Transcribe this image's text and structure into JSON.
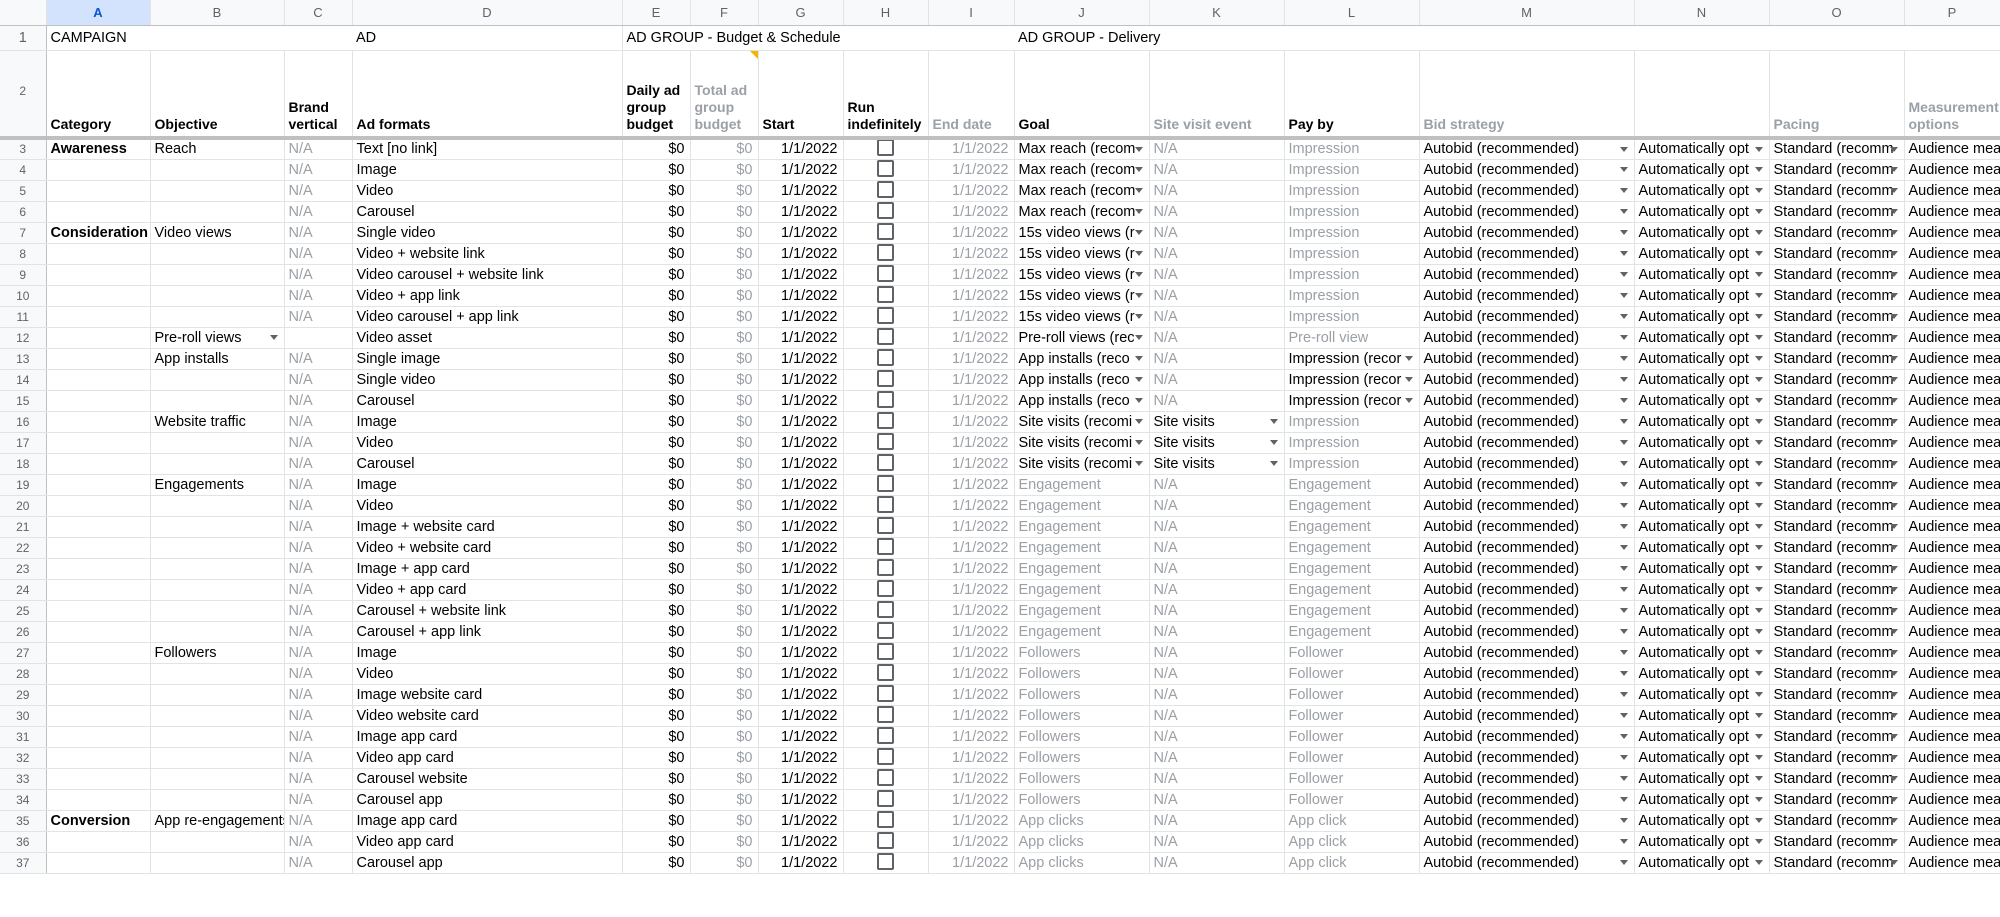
{
  "columns": [
    "A",
    "B",
    "C",
    "D",
    "E",
    "F",
    "G",
    "H",
    "I",
    "J",
    "K",
    "L",
    "M",
    "N",
    "O",
    "P"
  ],
  "row1": {
    "campaign": "CAMPAIGN",
    "ad": "AD",
    "budget_schedule": "AD GROUP - Budget & Schedule",
    "delivery": "AD GROUP - Delivery"
  },
  "headers": {
    "category": "Category",
    "objective": "Objective",
    "brand_vertical": "Brand vertical",
    "ad_formats": "Ad formats",
    "daily_budget": "Daily ad group budget",
    "total_budget": "Total ad group budget",
    "start": "Start",
    "run_indefinitely": "Run indefinitely",
    "end_date": "End date",
    "goal": "Goal",
    "site_visit_event": "Site visit event",
    "pay_by": "Pay by",
    "bid_strategy": "Bid strategy",
    "n_header": "",
    "pacing": "Pacing",
    "measurement": "Measurement options"
  },
  "defaults": {
    "brand_vertical": "N/A",
    "daily_budget": "$0",
    "total_budget": "$0",
    "start": "1/1/2022",
    "end_date": "1/1/2022",
    "bid_strategy": "Autobid (recommended)",
    "n_value": "Automatically opt",
    "pacing": "Standard (recomm",
    "measurement": "Audience meas"
  },
  "rows": [
    {
      "n": "3",
      "cat": "Awareness",
      "obj": "Reach",
      "bv": "N/A",
      "fmt": "Text [no link]",
      "goal": "Max reach (recom",
      "gd": true,
      "site": "N/A",
      "sd": false,
      "pay": "Impression",
      "pg": true,
      "pd": false
    },
    {
      "n": "4",
      "cat": "",
      "obj": "",
      "bv": "N/A",
      "fmt": "Image",
      "goal": "Max reach (recom",
      "gd": true,
      "site": "N/A",
      "sd": false,
      "pay": "Impression",
      "pg": true,
      "pd": false
    },
    {
      "n": "5",
      "cat": "",
      "obj": "",
      "bv": "N/A",
      "fmt": "Video",
      "goal": "Max reach (recom",
      "gd": true,
      "site": "N/A",
      "sd": false,
      "pay": "Impression",
      "pg": true,
      "pd": false
    },
    {
      "n": "6",
      "cat": "",
      "obj": "",
      "bv": "N/A",
      "fmt": "Carousel",
      "goal": "Max reach (recom",
      "gd": true,
      "site": "N/A",
      "sd": false,
      "pay": "Impression",
      "pg": true,
      "pd": false
    },
    {
      "n": "7",
      "cat": "Consideration",
      "obj": "Video views",
      "bv": "N/A",
      "fmt": "Single video",
      "goal": "15s video views (r",
      "gd": true,
      "site": "N/A",
      "sd": false,
      "pay": "Impression",
      "pg": true,
      "pd": false
    },
    {
      "n": "8",
      "cat": "",
      "obj": "",
      "bv": "N/A",
      "fmt": "Video + website link",
      "goal": "15s video views (r",
      "gd": true,
      "site": "N/A",
      "sd": false,
      "pay": "Impression",
      "pg": true,
      "pd": false
    },
    {
      "n": "9",
      "cat": "",
      "obj": "",
      "bv": "N/A",
      "fmt": "Video carousel + website link",
      "goal": "15s video views (r",
      "gd": true,
      "site": "N/A",
      "sd": false,
      "pay": "Impression",
      "pg": true,
      "pd": false
    },
    {
      "n": "10",
      "cat": "",
      "obj": "",
      "bv": "N/A",
      "fmt": "Video + app link",
      "goal": "15s video views (r",
      "gd": true,
      "site": "N/A",
      "sd": false,
      "pay": "Impression",
      "pg": true,
      "pd": false
    },
    {
      "n": "11",
      "cat": "",
      "obj": "",
      "bv": "N/A",
      "fmt": "Video carousel + app link",
      "goal": "15s video views (r",
      "gd": true,
      "site": "N/A",
      "sd": false,
      "pay": "Impression",
      "pg": true,
      "pd": false
    },
    {
      "n": "12",
      "cat": "",
      "obj": "Pre-roll views",
      "od": true,
      "bv": "",
      "fmt": "Video asset",
      "goal": "Pre-roll views (rec",
      "gd": true,
      "site": "N/A",
      "sd": false,
      "pay": "Pre-roll view",
      "pg": true,
      "pd": false
    },
    {
      "n": "13",
      "cat": "",
      "obj": "App installs",
      "bv": "N/A",
      "fmt": "Single image",
      "goal": "App installs (reco",
      "gd": true,
      "site": "N/A",
      "sd": false,
      "pay": "Impression (recor",
      "pg": false,
      "pd": true
    },
    {
      "n": "14",
      "cat": "",
      "obj": "",
      "bv": "N/A",
      "fmt": "Single video",
      "goal": "App installs (reco",
      "gd": true,
      "site": "N/A",
      "sd": false,
      "pay": "Impression (recor",
      "pg": false,
      "pd": true
    },
    {
      "n": "15",
      "cat": "",
      "obj": "",
      "bv": "N/A",
      "fmt": "Carousel",
      "goal": "App installs (reco",
      "gd": true,
      "site": "N/A",
      "sd": false,
      "pay": "Impression (recor",
      "pg": false,
      "pd": true
    },
    {
      "n": "16",
      "cat": "",
      "obj": "Website traffic",
      "bv": "N/A",
      "fmt": "Image",
      "goal": "Site visits (recomi",
      "gd": true,
      "site": "Site visits",
      "sd": true,
      "pay": "Impression",
      "pg": true,
      "pd": false
    },
    {
      "n": "17",
      "cat": "",
      "obj": "",
      "bv": "N/A",
      "fmt": "Video",
      "goal": "Site visits (recomi",
      "gd": true,
      "site": "Site visits",
      "sd": true,
      "pay": "Impression",
      "pg": true,
      "pd": false
    },
    {
      "n": "18",
      "cat": "",
      "obj": "",
      "bv": "N/A",
      "fmt": "Carousel",
      "goal": "Site visits (recomi",
      "gd": true,
      "site": "Site visits",
      "sd": true,
      "pay": "Impression",
      "pg": true,
      "pd": false
    },
    {
      "n": "19",
      "cat": "",
      "obj": "Engagements",
      "bv": "N/A",
      "fmt": "Image",
      "goal": "Engagement",
      "gd": false,
      "site": "N/A",
      "sd": false,
      "pay": "Engagement",
      "pg": true,
      "pd": false
    },
    {
      "n": "20",
      "cat": "",
      "obj": "",
      "bv": "N/A",
      "fmt": "Video",
      "goal": "Engagement",
      "gd": false,
      "site": "N/A",
      "sd": false,
      "pay": "Engagement",
      "pg": true,
      "pd": false
    },
    {
      "n": "21",
      "cat": "",
      "obj": "",
      "bv": "N/A",
      "fmt": "Image + website card",
      "goal": "Engagement",
      "gd": false,
      "site": "N/A",
      "sd": false,
      "pay": "Engagement",
      "pg": true,
      "pd": false
    },
    {
      "n": "22",
      "cat": "",
      "obj": "",
      "bv": "N/A",
      "fmt": "Video + website card",
      "goal": "Engagement",
      "gd": false,
      "site": "N/A",
      "sd": false,
      "pay": "Engagement",
      "pg": true,
      "pd": false
    },
    {
      "n": "23",
      "cat": "",
      "obj": "",
      "bv": "N/A",
      "fmt": "Image + app card",
      "goal": "Engagement",
      "gd": false,
      "site": "N/A",
      "sd": false,
      "pay": "Engagement",
      "pg": true,
      "pd": false
    },
    {
      "n": "24",
      "cat": "",
      "obj": "",
      "bv": "N/A",
      "fmt": "Video + app card",
      "goal": "Engagement",
      "gd": false,
      "site": "N/A",
      "sd": false,
      "pay": "Engagement",
      "pg": true,
      "pd": false
    },
    {
      "n": "25",
      "cat": "",
      "obj": "",
      "bv": "N/A",
      "fmt": "Carousel + website link",
      "goal": "Engagement",
      "gd": false,
      "site": "N/A",
      "sd": false,
      "pay": "Engagement",
      "pg": true,
      "pd": false
    },
    {
      "n": "26",
      "cat": "",
      "obj": "",
      "bv": "N/A",
      "fmt": "Carousel + app link",
      "goal": "Engagement",
      "gd": false,
      "site": "N/A",
      "sd": false,
      "pay": "Engagement",
      "pg": true,
      "pd": false
    },
    {
      "n": "27",
      "cat": "",
      "obj": "Followers",
      "bv": "N/A",
      "fmt": "Image",
      "goal": "Followers",
      "gd": false,
      "site": "N/A",
      "sd": false,
      "pay": "Follower",
      "pg": true,
      "pd": false
    },
    {
      "n": "28",
      "cat": "",
      "obj": "",
      "bv": "N/A",
      "fmt": "Video",
      "goal": "Followers",
      "gd": false,
      "site": "N/A",
      "sd": false,
      "pay": "Follower",
      "pg": true,
      "pd": false
    },
    {
      "n": "29",
      "cat": "",
      "obj": "",
      "bv": "N/A",
      "fmt": "Image website card",
      "goal": "Followers",
      "gd": false,
      "site": "N/A",
      "sd": false,
      "pay": "Follower",
      "pg": true,
      "pd": false
    },
    {
      "n": "30",
      "cat": "",
      "obj": "",
      "bv": "N/A",
      "fmt": "Video website card",
      "goal": "Followers",
      "gd": false,
      "site": "N/A",
      "sd": false,
      "pay": "Follower",
      "pg": true,
      "pd": false
    },
    {
      "n": "31",
      "cat": "",
      "obj": "",
      "bv": "N/A",
      "fmt": "Image app card",
      "goal": "Followers",
      "gd": false,
      "site": "N/A",
      "sd": false,
      "pay": "Follower",
      "pg": true,
      "pd": false
    },
    {
      "n": "32",
      "cat": "",
      "obj": "",
      "bv": "N/A",
      "fmt": "Video app card",
      "goal": "Followers",
      "gd": false,
      "site": "N/A",
      "sd": false,
      "pay": "Follower",
      "pg": true,
      "pd": false
    },
    {
      "n": "33",
      "cat": "",
      "obj": "",
      "bv": "N/A",
      "fmt": "Carousel website",
      "goal": "Followers",
      "gd": false,
      "site": "N/A",
      "sd": false,
      "pay": "Follower",
      "pg": true,
      "pd": false
    },
    {
      "n": "34",
      "cat": "",
      "obj": "",
      "bv": "N/A",
      "fmt": "Carousel app",
      "goal": "Followers",
      "gd": false,
      "site": "N/A",
      "sd": false,
      "pay": "Follower",
      "pg": true,
      "pd": false
    },
    {
      "n": "35",
      "cat": "Conversion",
      "obj": "App re-engagements",
      "bv": "N/A",
      "fmt": "Image app card",
      "goal": "App clicks",
      "gd": false,
      "site": "N/A",
      "sd": false,
      "pay": "App click",
      "pg": true,
      "pd": false
    },
    {
      "n": "36",
      "cat": "",
      "obj": "",
      "bv": "N/A",
      "fmt": "Video app card",
      "goal": "App clicks",
      "gd": false,
      "site": "N/A",
      "sd": false,
      "pay": "App click",
      "pg": true,
      "pd": false
    },
    {
      "n": "37",
      "cat": "",
      "obj": "",
      "bv": "N/A",
      "fmt": "Carousel app",
      "goal": "App clicks",
      "gd": false,
      "site": "N/A",
      "sd": false,
      "pay": "App click",
      "pg": true,
      "pd": false
    }
  ]
}
